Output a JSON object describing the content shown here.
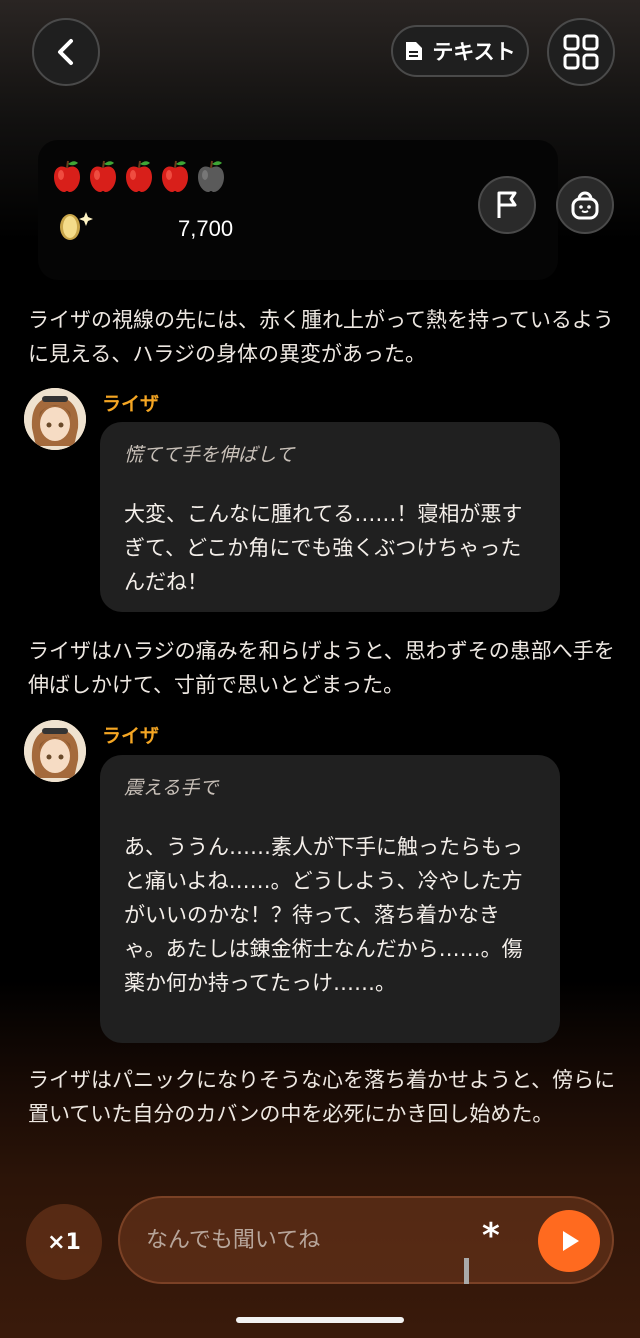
{
  "header": {
    "back_icon": "chevron-left-icon",
    "text_button_label": "テキスト",
    "text_icon": "document-icon",
    "menu_icon": "grid-icon"
  },
  "status": {
    "apples_filled": 4,
    "apples_total": 5,
    "coins": "7,700",
    "flag_icon": "flag-icon",
    "bag_icon": "bag-icon"
  },
  "story": {
    "narration_1": "ライザの視線の先には、赤く腫れ上がって熱を持っているように見える、ハラジの身体の異変があった。",
    "message_1": {
      "speaker": "ライザ",
      "action": "慌てて手を伸ばして",
      "speech": "大変、こんなに腫れてる……！寝相が悪すぎて、どこか角にでも強くぶつけちゃったんだね！"
    },
    "narration_2": "ライザはハラジの痛みを和らげようと、思わずその患部へ手を伸ばしかけて、寸前で思いとどまった。",
    "message_2": {
      "speaker": "ライザ",
      "action": "震える手で",
      "speech": "あ、ううん……素人が下手に触ったらもっと痛いよね……。どうしよう、冷やした方がいいのかな！？待って、落ち着かなきゃ。あたしは錬金術士なんだから……。傷薬か何か持ってたっけ……。"
    },
    "narration_3": "ライザはパニックになりそうな心を落ち着かせようと、傍らに置いていた自分のカバンの中を必死にかき回し始めた。"
  },
  "composer": {
    "speed_label": "×1",
    "placeholder": "なんでも聞いてね",
    "asterisk": "*",
    "send_icon": "play-icon"
  }
}
